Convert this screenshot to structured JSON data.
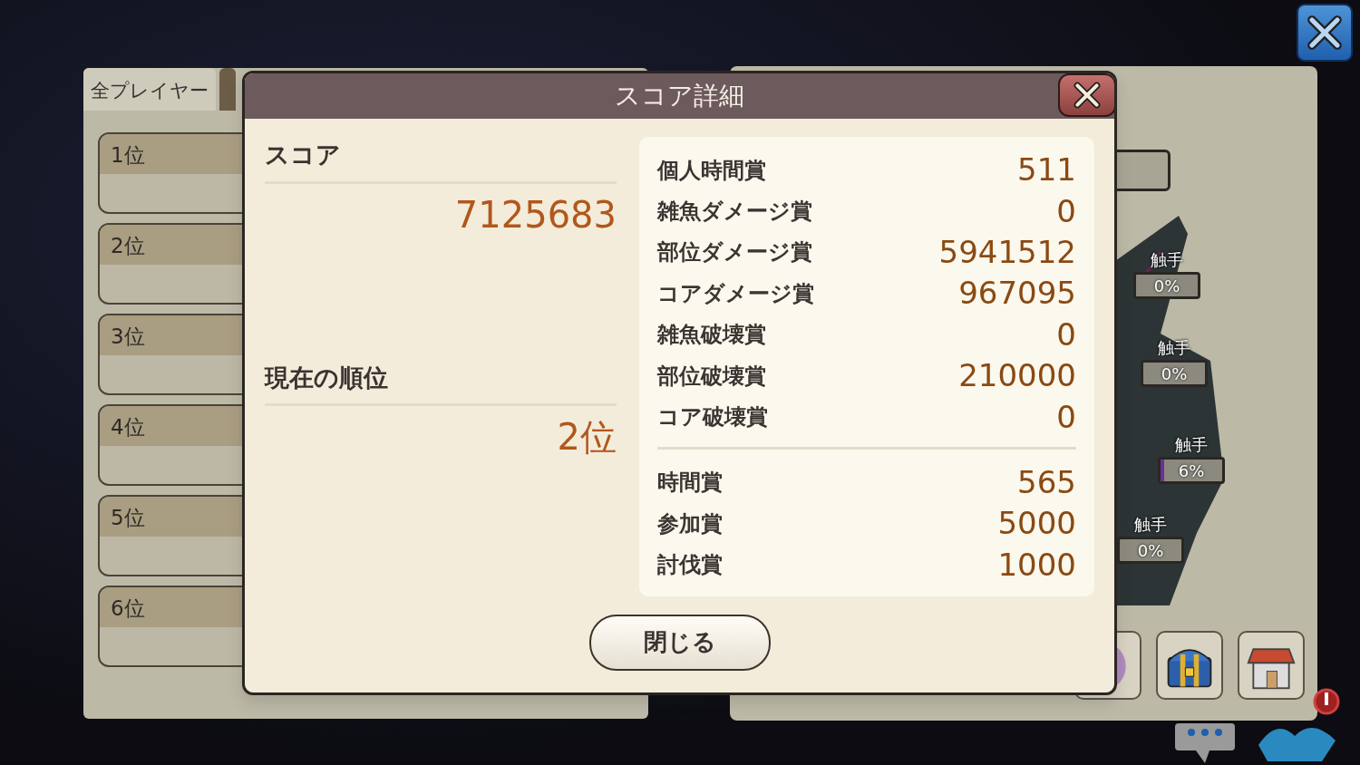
{
  "tabs": [
    {
      "label": "全プレイヤー",
      "selected": true
    },
    {
      "selected": false
    }
  ],
  "ranking": [
    {
      "rank": "1位"
    },
    {
      "rank": "2位"
    },
    {
      "rank": "3位"
    },
    {
      "rank": "4位"
    },
    {
      "rank": "5位"
    },
    {
      "rank": "6位"
    }
  ],
  "parts": [
    {
      "label": "触手",
      "reading": "0%",
      "level": 0
    },
    {
      "label": "触手",
      "reading": "0%",
      "level": 0
    },
    {
      "label": "触手",
      "reading": "6%",
      "level": 0.06
    },
    {
      "label": "触手",
      "reading": "0%",
      "level": 0
    }
  ],
  "dialog": {
    "title": "スコア詳細",
    "score_label": "スコア",
    "score": "7125683",
    "rank_label": "現在の順位",
    "rank": "2位",
    "awards": [
      {
        "label": "個人時間賞",
        "value": "511"
      },
      {
        "label": "雑魚ダメージ賞",
        "value": "0"
      },
      {
        "label": "部位ダメージ賞",
        "value": "5941512"
      },
      {
        "label": "コアダメージ賞",
        "value": "967095"
      },
      {
        "label": "雑魚破壊賞",
        "value": "0"
      },
      {
        "label": "部位破壊賞",
        "value": "210000"
      },
      {
        "label": "コア破壊賞",
        "value": "0"
      }
    ],
    "bonuses": [
      {
        "label": "時間賞",
        "value": "565"
      },
      {
        "label": "参加賞",
        "value": "5000"
      },
      {
        "label": "討伐賞",
        "value": "1000"
      }
    ],
    "close_label": "閉じる"
  }
}
